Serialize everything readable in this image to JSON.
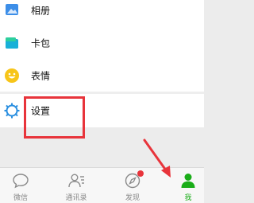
{
  "menu": {
    "items": [
      {
        "label": "相册",
        "icon": "album-icon"
      },
      {
        "label": "卡包",
        "icon": "card-wallet-icon"
      },
      {
        "label": "表情",
        "icon": "sticker-smiley-icon"
      },
      {
        "label": "设置",
        "icon": "settings-gear-icon"
      }
    ]
  },
  "tabbar": {
    "tabs": [
      {
        "label": "微信",
        "icon": "chat-bubble-icon",
        "active": false
      },
      {
        "label": "通讯录",
        "icon": "contacts-icon",
        "active": false
      },
      {
        "label": "发现",
        "icon": "compass-icon",
        "active": false,
        "badge": true
      },
      {
        "label": "我",
        "icon": "person-icon",
        "active": true
      }
    ]
  },
  "colors": {
    "accent": "#1aad19",
    "highlight": "#e8343b",
    "badge": "#e8343b",
    "background": "#ececec"
  }
}
